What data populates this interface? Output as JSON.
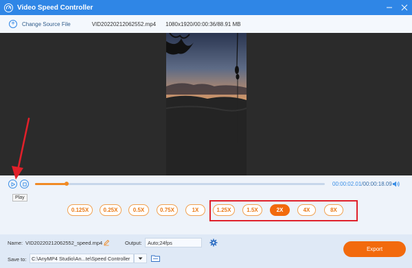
{
  "window": {
    "title": "Video Speed Controller"
  },
  "source": {
    "change_label": "Change Source File",
    "filename": "VID20220212062552.mp4",
    "info": "1080x1920/00:00:36/88.91 MB"
  },
  "playback": {
    "current_time": "00:00:02.01",
    "separator": "/",
    "total_time": "00:00:18.09",
    "progress": 0.11,
    "tooltip": "Play"
  },
  "speeds": {
    "options": [
      "0.125X",
      "0.25X",
      "0.5X",
      "0.75X",
      "1X",
      "1.25X",
      "1.5X",
      "2X",
      "4X",
      "8X"
    ],
    "selected": "2X"
  },
  "bottom": {
    "name_label": "Name:",
    "name_value": "VID20220212062552_speed.mp4",
    "output_label": "Output:",
    "output_value": "Auto;24fps",
    "saveto_label": "Save to:",
    "saveto_value": "C:\\AnyMP4 Studio\\An...te\\Speed Controller",
    "export_label": "Export"
  },
  "colors": {
    "accent_blue": "#2f86e6",
    "accent_orange": "#f26a0d",
    "highlight_red": "#e0202a"
  }
}
